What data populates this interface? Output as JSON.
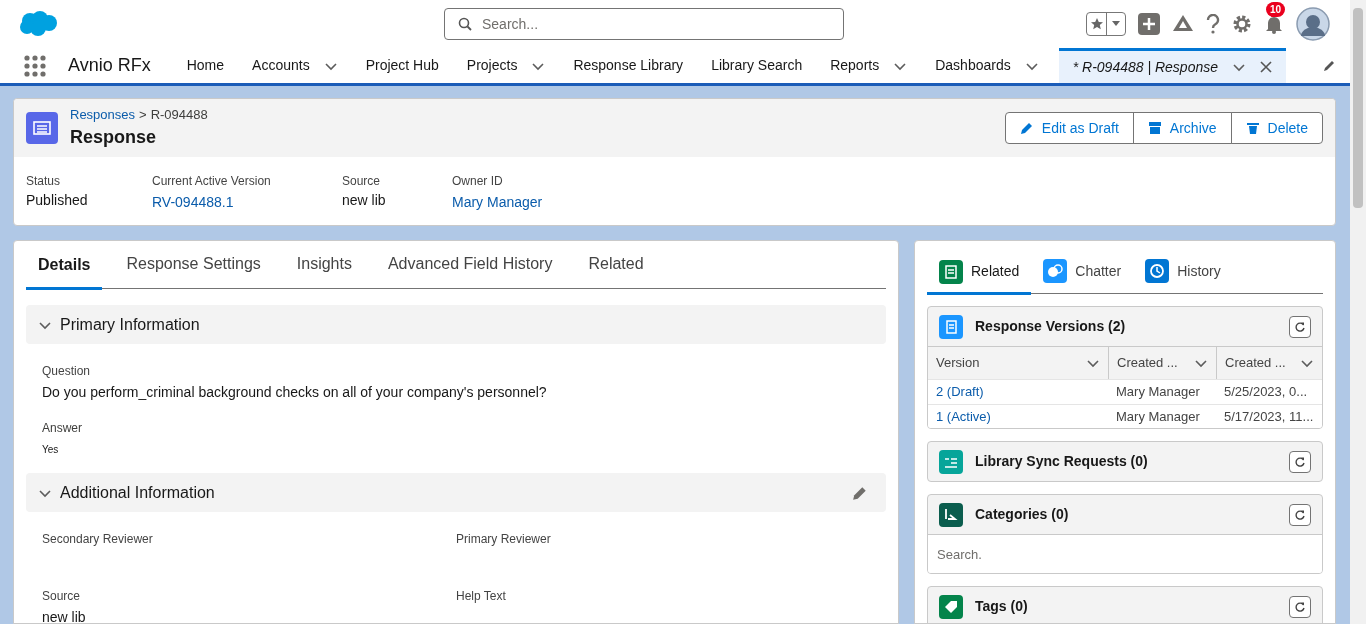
{
  "header": {
    "search": {
      "placeholder": "Search..."
    },
    "notification_count": "10"
  },
  "nav": {
    "app_name": "Avnio RFx",
    "items": [
      {
        "label": "Home",
        "has_menu": false,
        "kind": "link",
        "selected": false
      },
      {
        "label": "Accounts",
        "has_menu": true,
        "kind": "link",
        "selected": false
      },
      {
        "label": "Project Hub",
        "has_menu": false,
        "kind": "link",
        "selected": false
      },
      {
        "label": "Projects",
        "has_menu": true,
        "kind": "link",
        "selected": false
      },
      {
        "label": "Response Library",
        "has_menu": false,
        "kind": "link",
        "selected": false
      },
      {
        "label": "Library Search",
        "has_menu": false,
        "kind": "link",
        "selected": false
      },
      {
        "label": "Reports",
        "has_menu": true,
        "kind": "link",
        "selected": false
      },
      {
        "label": "Dashboards",
        "has_menu": true,
        "kind": "link",
        "selected": false
      },
      {
        "label": "* R-094488 | Response",
        "has_menu": true,
        "kind": "record",
        "selected": true
      }
    ]
  },
  "record": {
    "breadcrumb": {
      "link": "Responses",
      "separator": ">",
      "current": "R-094488"
    },
    "title": "Response",
    "actions": [
      {
        "label": "Edit as Draft",
        "kind": "edit"
      },
      {
        "label": "Archive",
        "kind": "archive"
      },
      {
        "label": "Delete",
        "kind": "delete"
      }
    ],
    "highlights": [
      {
        "label": "Status",
        "value": "Published",
        "kind": "text"
      },
      {
        "label": "Current Active Version",
        "value": "RV-094488.1",
        "kind": "link"
      },
      {
        "label": "Source",
        "value": "new lib",
        "kind": "text"
      },
      {
        "label": "Owner ID",
        "value": "Mary Manager",
        "kind": "link"
      }
    ]
  },
  "detail_tabs": [
    {
      "label": "Details",
      "selected": true
    },
    {
      "label": "Response Settings",
      "selected": false
    },
    {
      "label": "Insights",
      "selected": false
    },
    {
      "label": "Advanced Field History",
      "selected": false
    },
    {
      "label": "Related",
      "selected": false
    }
  ],
  "sections": [
    {
      "title": "Primary Information",
      "expanded": true,
      "editable": false,
      "kind": "stack",
      "fields": [
        {
          "label": "Question",
          "value": "Do you perform_criminal background checks on all of your company's personnel?",
          "kind": "text"
        },
        {
          "label": "Answer",
          "value": "Yes",
          "kind": "small"
        }
      ]
    },
    {
      "title": "Additional Information",
      "expanded": true,
      "editable": true,
      "kind": "grid",
      "fields": [
        {
          "label": "Secondary Reviewer",
          "kind": "text"
        },
        {
          "label": "Primary Reviewer",
          "kind": "text"
        },
        {
          "label": "Source",
          "value": "new lib",
          "kind": "text"
        },
        {
          "label": "Help Text",
          "kind": "text"
        }
      ]
    }
  ],
  "side_tabs": [
    {
      "label": "Related",
      "selected": true,
      "kind": "related",
      "color": "#04844b"
    },
    {
      "label": "Chatter",
      "selected": false,
      "kind": "chatter",
      "color": "#1b96ff"
    },
    {
      "label": "History",
      "selected": false,
      "kind": "history",
      "color": "#0176d3"
    }
  ],
  "related_lists": [
    {
      "title": "Response Versions (2)",
      "kind": "versions",
      "color": "#1b96ff",
      "table": {
        "columns": [
          "Version",
          "Created ...",
          "Created ..."
        ],
        "rows": [
          [
            "2 (Draft)",
            "Mary Manager",
            "5/25/2023, 0..."
          ],
          [
            "1 (Active)",
            "Mary Manager",
            "5/17/2023, 11..."
          ]
        ]
      }
    },
    {
      "title": "Library Sync Requests (0)",
      "kind": "sync",
      "color": "#06a59a"
    },
    {
      "title": "Categories (0)",
      "kind": "categories",
      "color": "#0b5d4e",
      "search": {
        "placeholder": "Search."
      }
    },
    {
      "title": "Tags (0)",
      "kind": "tags",
      "color": "#04844b"
    }
  ]
}
